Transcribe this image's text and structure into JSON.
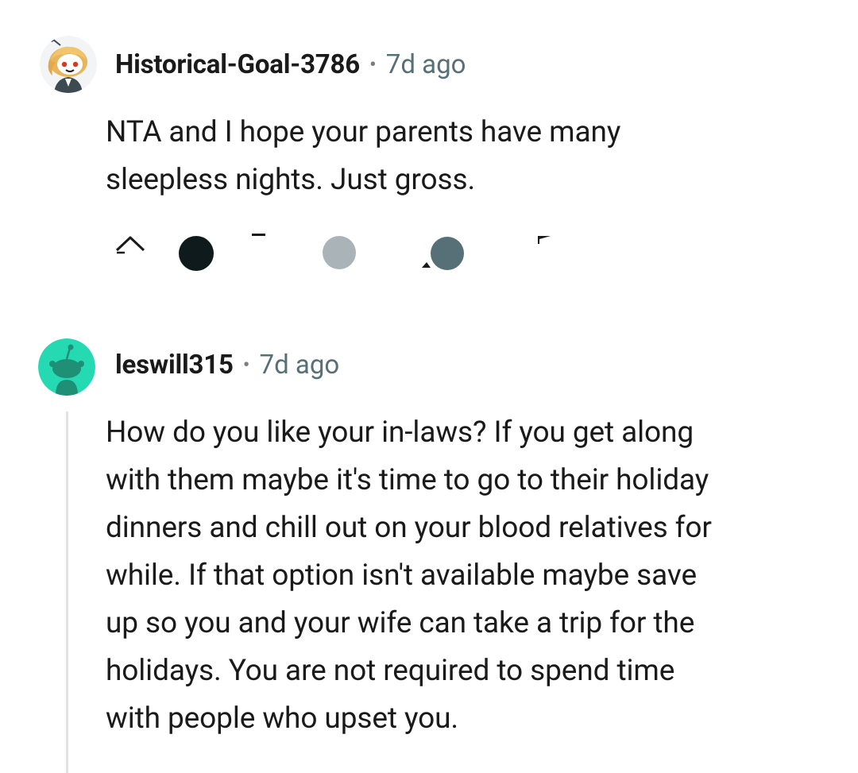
{
  "comments": [
    {
      "username": "Historical-Goal-3786",
      "time": "7d ago",
      "avatar_icon": "snoo-avatar-blonde-icon",
      "lines": [
        "NTA and I hope your parents have many",
        "sleepless nights. Just gross."
      ]
    },
    {
      "username": "leswill315",
      "time": "7d ago",
      "avatar_icon": "snoo-avatar-teal-icon",
      "lines": [
        "How do you like your in-laws? If you get along",
        "with them maybe it's time to go to their holiday",
        "dinners and chill out on your blood relatives for",
        "while. If that option isn't available maybe save",
        "up so you and your wife can take a trip for the",
        "holidays. You are not required to spend time",
        "with people who upset you."
      ]
    }
  ],
  "separator": "•",
  "colors": {
    "teal_avatar_bg": "#25d9b3",
    "thread_line": "#dfe3e5",
    "meta_gray": "#576f76"
  }
}
